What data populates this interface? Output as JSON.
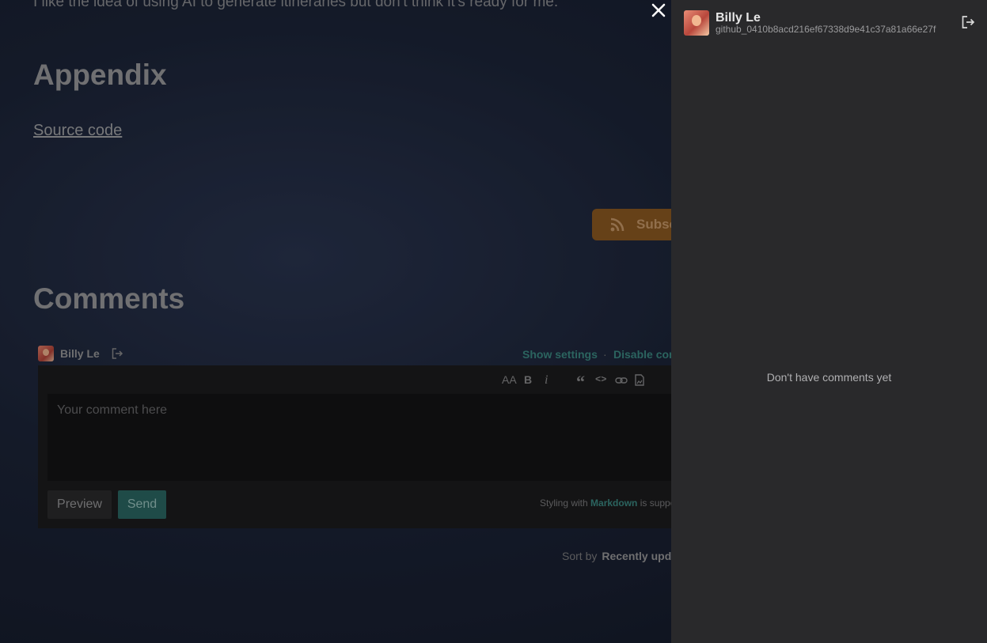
{
  "article": {
    "intro_text": "I like the idea of using AI to generate itineraries but don't think it's ready for me.",
    "appendix_heading": "Appendix",
    "source_link": "Source code",
    "subscribe_label": "Subscribe"
  },
  "comments": {
    "heading": "Comments",
    "user_name": "Billy Le",
    "show_settings": "Show settings",
    "separator": "·",
    "disable_label": "Disable comments",
    "toolbar": {
      "heading_glyph": "AA",
      "bold_glyph": "B",
      "italic_glyph": "i",
      "quote_glyph": "“",
      "code_glyph": "<>",
      "more_glyph": "⋮"
    },
    "placeholder": "Your comment here",
    "preview_label": "Preview",
    "send_label": "Send",
    "markdown_prefix": "Styling with ",
    "markdown_link": "Markdown",
    "markdown_suffix": " is supported",
    "sort_label": "Sort by",
    "sort_value": "Recently updated"
  },
  "panel": {
    "user_name": "Billy Le",
    "user_id": "github_0410b8acd216ef67338d9e41c37a81a66e27f",
    "empty_message": "Don't have comments yet"
  },
  "colors": {
    "accent": "#3c8b84",
    "subscribe": "#8e5a22",
    "panel_bg": "#29292b"
  },
  "icons": [
    "close-icon",
    "rss-icon",
    "logout-icon",
    "link-icon",
    "image-icon"
  ]
}
